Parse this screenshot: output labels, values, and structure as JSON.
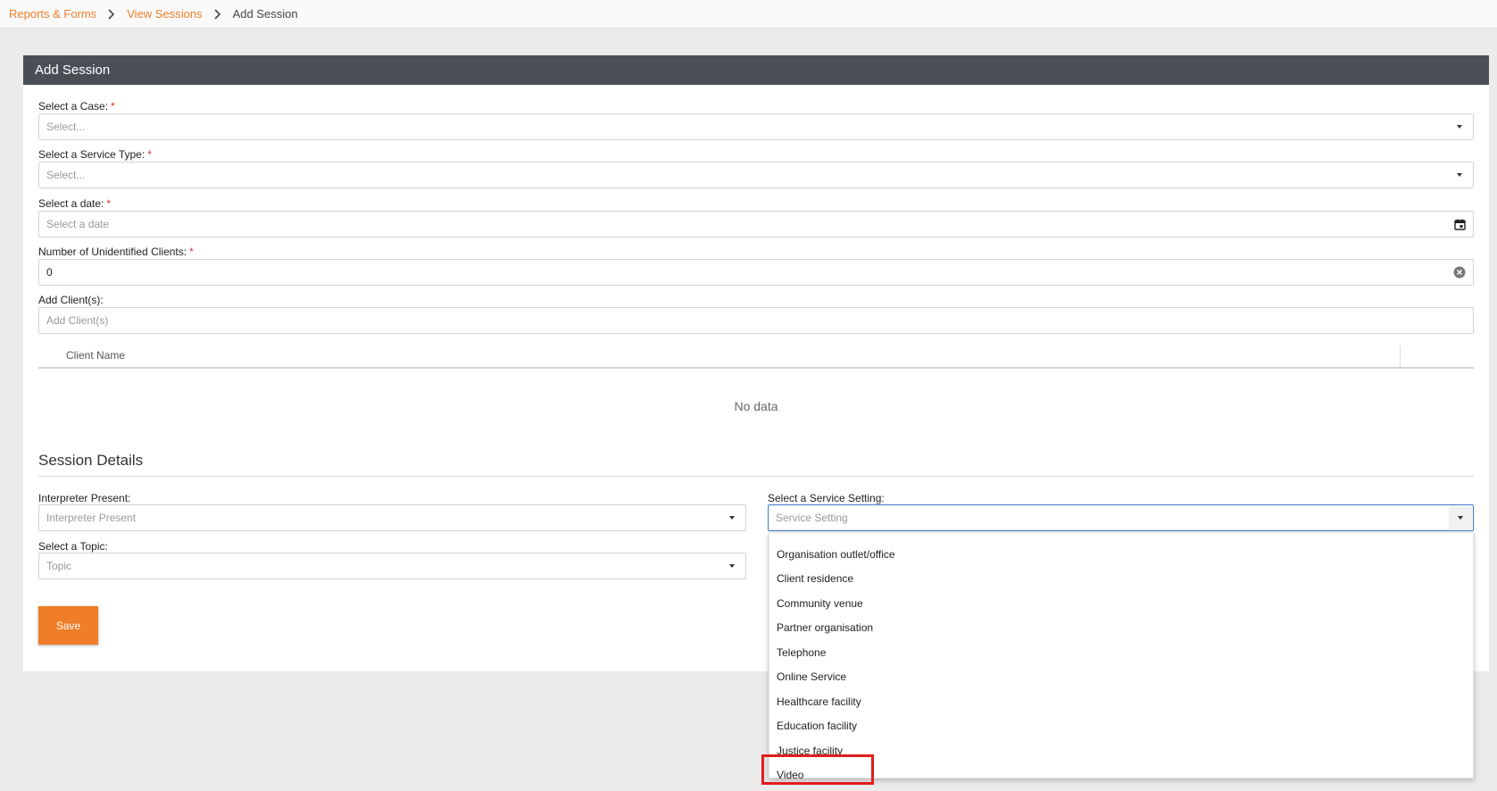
{
  "breadcrumb": {
    "items": [
      "Reports & Forms",
      "View Sessions"
    ],
    "current": "Add Session"
  },
  "panel": {
    "title": "Add Session"
  },
  "fields": {
    "case": {
      "label": "Select a Case:",
      "required": "*",
      "placeholder": "Select..."
    },
    "service_type": {
      "label": "Select a Service Type:",
      "required": "*",
      "placeholder": "Select..."
    },
    "date": {
      "label": "Select a date:",
      "required": "*",
      "placeholder": "Select a date"
    },
    "unidentified_clients": {
      "label": "Number of Unidentified Clients:",
      "required": "*",
      "value": "0"
    },
    "add_clients": {
      "label": "Add Client(s):",
      "placeholder": "Add Client(s)"
    }
  },
  "clients_table": {
    "columns": [
      "Client Name"
    ],
    "empty_text": "No data"
  },
  "session_details": {
    "title": "Session Details",
    "interpreter": {
      "label": "Interpreter Present:",
      "placeholder": "Interpreter Present"
    },
    "topic": {
      "label": "Select a Topic:",
      "placeholder": "Topic"
    },
    "service_setting": {
      "label": "Select a Service Setting:",
      "placeholder": "Service Setting",
      "options": [
        "Organisation outlet/office",
        "Client residence",
        "Community venue",
        "Partner organisation",
        "Telephone",
        "Online Service",
        "Healthcare facility",
        "Education facility",
        "Justice facility",
        "Video"
      ]
    }
  },
  "save_label": "Save",
  "colors": {
    "accent": "#f07d27",
    "header": "#4a4e55",
    "required": "#e0342c",
    "highlight": "#e21d1d",
    "focus": "#3c78c4"
  }
}
